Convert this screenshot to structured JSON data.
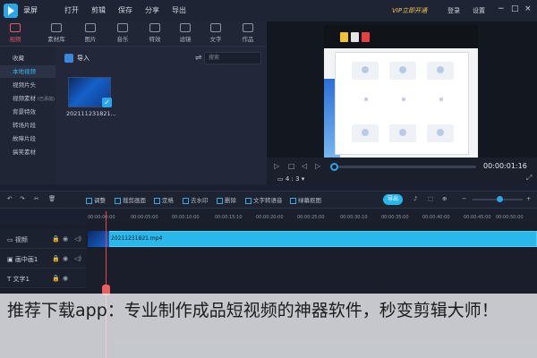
{
  "app": {
    "name": "录屏",
    "vip_label": "VIP立即开通",
    "login_label": "登录",
    "settings_label": "设置"
  },
  "menu": [
    "打开",
    "剪辑",
    "保存",
    "分享",
    "导出"
  ],
  "media_tabs": [
    "视频",
    "素材库",
    "图片",
    "音乐",
    "特效",
    "滤镜",
    "文字",
    "作品"
  ],
  "sidebar": {
    "items": [
      "收藏",
      "本地视频",
      "视频片头",
      "视频素材",
      "背景特效",
      "转场片段",
      "故障片段",
      "搞笑素材"
    ],
    "badge": "(已添加)"
  },
  "library": {
    "import_label": "导入",
    "search_placeholder": "搜索",
    "clip_name": "202111231821..."
  },
  "player": {
    "timecode": "00:00:01:16",
    "aspect_ratio": "4 : 3"
  },
  "toolbar": {
    "items": [
      "调整",
      "裁剪画面",
      "定格",
      "去水印",
      "删除",
      "文字转语音",
      "绿幕抠图"
    ],
    "export_label": "导出"
  },
  "ruler": [
    "00:00:00:00",
    "00:00:05:00",
    "00:00:10:00",
    "00:00:15:10",
    "00:00:20:00",
    "00:00:25:00",
    "00:00:30:10",
    "00:00:35:00",
    "00:00:40:00",
    "00:00:45:00",
    "00:00:50:00"
  ],
  "tracks": [
    "视频",
    "画中画1",
    "文字1"
  ],
  "timeline_clip": "20211231821.mp4",
  "caption": "推荐下载app：专业制作成品短视频的神器软件，秒变剪辑大师！",
  "colors": {
    "accent": "#2aa6e8",
    "active_tab": "#e65a5a",
    "playhead": "#e84545"
  }
}
